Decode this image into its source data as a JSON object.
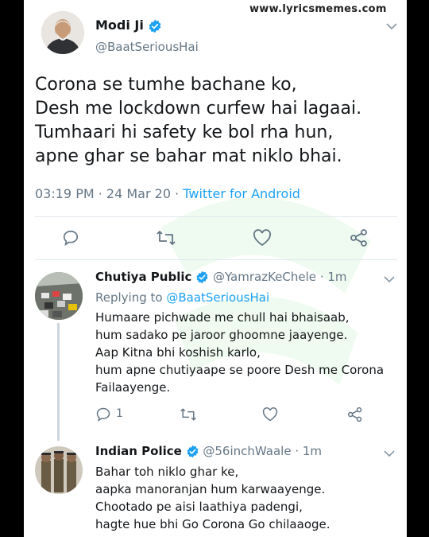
{
  "watermark": "www.lyricsmemes.com",
  "main_tweet": {
    "name": "Modi Ji",
    "handle": "@BaatSeriousHai",
    "lines": [
      "Corona se tumhe bachane ko,",
      "Desh me lockdown curfew hai lagaai.",
      "Tumhaari hi safety ke bol rha hun,",
      "apne ghar se bahar mat niklo bhai."
    ],
    "time": "03:19 PM",
    "date": "24 Mar 20",
    "source": "Twitter for Android",
    "separator": " · "
  },
  "replies": [
    {
      "name": "Chutiya Public",
      "handle": "@YamrazKeChele",
      "age": "1m",
      "replying_label": "Replying to",
      "replying_to": "@BaatSeriousHai",
      "lines": [
        "Humaare pichwade me chull hai bhaisaab,",
        "hum sadako pe jaroor ghoomne jaayenge.",
        "Aap Kitna bhi koshish karlo,",
        "hum apne chutiyaape se poore Desh me Corona",
        "Failaayenge."
      ],
      "reply_count": "1"
    },
    {
      "name": "Indian Police",
      "handle": "@56inchWaale",
      "age": "1m",
      "lines": [
        "Bahar toh niklo ghar ke,",
        "aapka manoranjan hum karwaayenge.",
        "Chootado pe aisi laathiya padengi,",
        "hagte hue bhi Go Corona Go chilaaoge."
      ]
    }
  ],
  "icons": {
    "verified": "verified-badge-icon",
    "reply": "reply-icon",
    "retweet": "retweet-icon",
    "like": "heart-icon",
    "share": "share-icon",
    "menu": "chevron-down-icon"
  },
  "colors": {
    "accent": "#1da1f2",
    "text": "#14171a",
    "muted": "#657786"
  }
}
